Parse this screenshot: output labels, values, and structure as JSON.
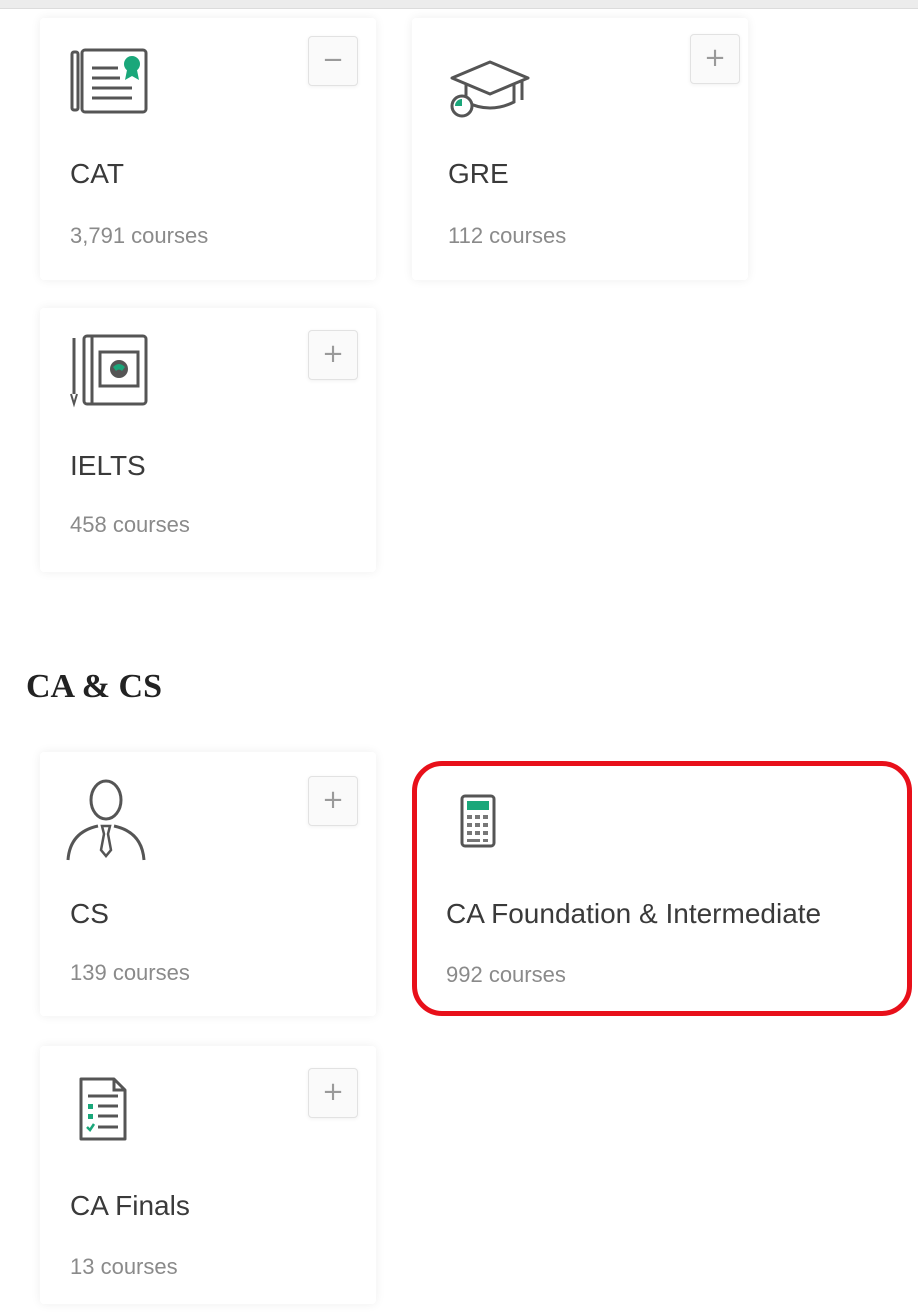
{
  "colors": {
    "accent": "#1aa77a",
    "highlight": "#e8101a"
  },
  "cards": {
    "cat": {
      "title": "CAT",
      "count": "3,791 courses",
      "toggle": "−",
      "icon": "certificate-icon"
    },
    "gre": {
      "title": "GRE",
      "count": "112 courses",
      "toggle": "+",
      "icon": "graduation-cap-icon"
    },
    "ielts": {
      "title": "IELTS",
      "count": "458 courses",
      "toggle": "+",
      "icon": "notebook-globe-icon"
    },
    "cs": {
      "title": "CS",
      "count": "139 courses",
      "toggle": "+",
      "icon": "person-tie-icon"
    },
    "ca_foundation": {
      "title": "CA Foundation & Intermediate",
      "count": "992 courses",
      "icon": "calculator-icon"
    },
    "ca_finals": {
      "title": "CA Finals",
      "count": "13 courses",
      "toggle": "+",
      "icon": "checklist-icon"
    }
  },
  "sections": {
    "ca_cs": {
      "heading": "CA & CS"
    }
  }
}
